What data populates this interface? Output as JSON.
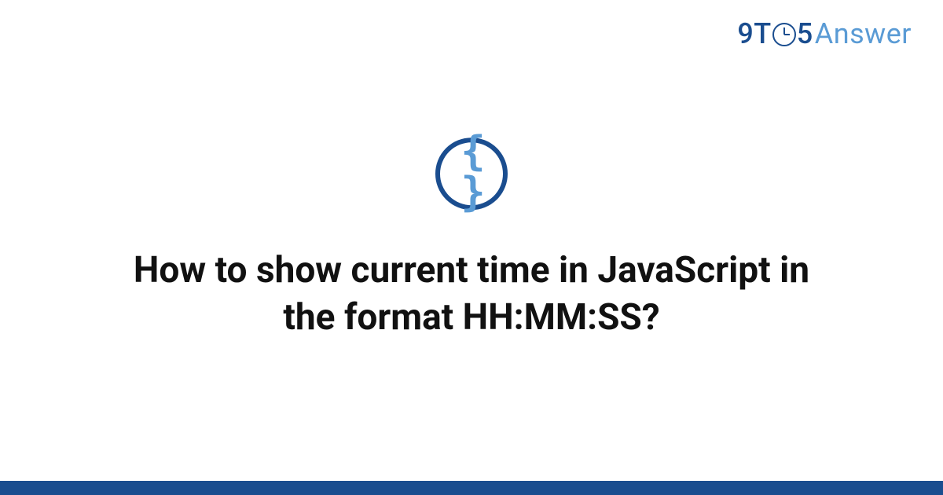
{
  "logo": {
    "nine": "9",
    "t": "T",
    "five": "5",
    "answer": "Answer"
  },
  "icon": {
    "braces": "{ }"
  },
  "title": "How to show current time in JavaScript in the format HH:MM:SS?",
  "colors": {
    "brand_dark": "#1a4d8f",
    "brand_light": "#5a9bd5"
  }
}
